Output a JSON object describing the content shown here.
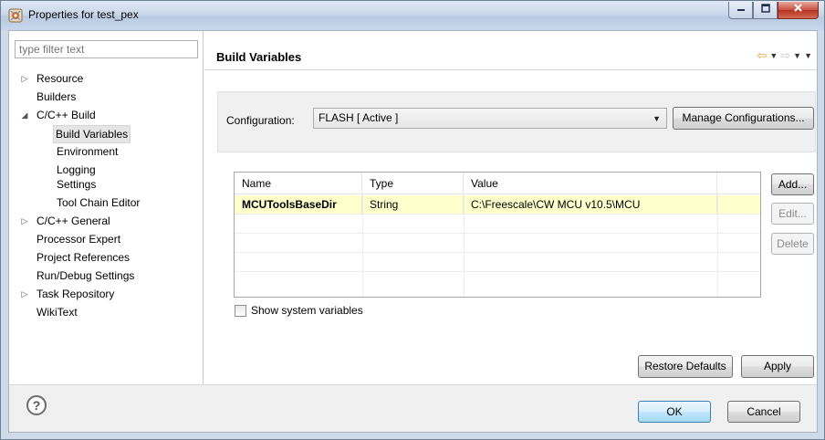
{
  "window": {
    "title": "Properties for test_pex",
    "icons": {
      "app": "properties-gear-icon",
      "minimize": "minimize-icon",
      "maximize": "maximize-icon",
      "close": "close-icon"
    }
  },
  "filter": {
    "placeholder": "type filter text"
  },
  "tree": [
    {
      "label": "Resource",
      "arrow": "▷"
    },
    {
      "label": "Builders",
      "arrow": ""
    },
    {
      "label": "C/C++ Build",
      "arrow": "◢"
    },
    {
      "label": "Build Variables",
      "arrow": "",
      "selected": true
    },
    {
      "label": "Environment",
      "arrow": ""
    },
    {
      "label": "Logging",
      "arrow": ""
    },
    {
      "label": "Settings",
      "arrow": ""
    },
    {
      "label": "Tool Chain Editor",
      "arrow": ""
    },
    {
      "label": "C/C++ General",
      "arrow": "▷"
    },
    {
      "label": "Processor Expert",
      "arrow": ""
    },
    {
      "label": "Project References",
      "arrow": ""
    },
    {
      "label": "Run/Debug Settings",
      "arrow": ""
    },
    {
      "label": "Task Repository",
      "arrow": "▷"
    },
    {
      "label": "WikiText",
      "arrow": ""
    }
  ],
  "page": {
    "title": "Build Variables",
    "nav": {
      "back_glyph": "⇦",
      "forward_glyph": "⇨",
      "dropdown_glyph": "▼",
      "back": "back-arrow-icon",
      "forward": "forward-arrow-icon"
    }
  },
  "configuration": {
    "label": "Configuration:",
    "value": "FLASH  [ Active ]",
    "dropdown_glyph": "▼",
    "manage_button": "Manage Configurations..."
  },
  "table": {
    "headers": [
      "Name",
      "Type",
      "Value"
    ],
    "rows": [
      {
        "name": "MCUToolsBaseDir",
        "type": "String",
        "value": "C:\\Freescale\\CW MCU v10.5\\MCU"
      }
    ]
  },
  "side_buttons": {
    "add": "Add...",
    "edit": "Edit...",
    "delete": "Delete"
  },
  "show_system_variables": {
    "label": "Show system variables",
    "checked": false
  },
  "bottom_buttons": {
    "restore": "Restore Defaults",
    "apply": "Apply"
  },
  "footer": {
    "help_glyph": "?",
    "ok": "OK",
    "cancel": "Cancel"
  },
  "colors": {
    "highlight_row": "#ffffcc",
    "nav_back": "#e7a33a",
    "default_button": "#3c7fb1"
  }
}
